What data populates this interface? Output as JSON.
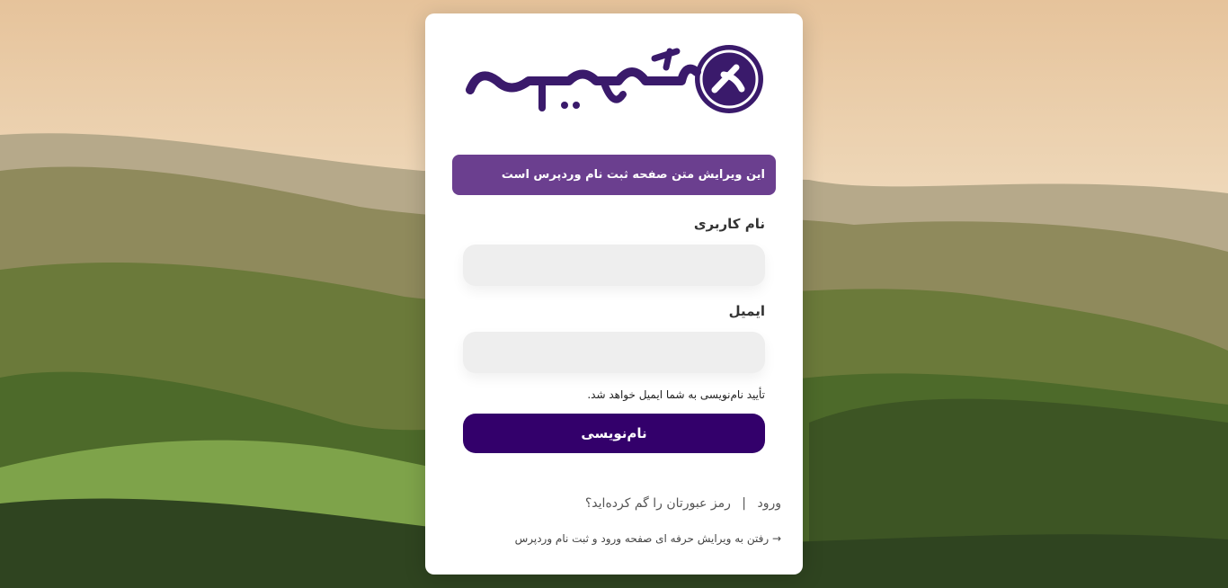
{
  "logo": {
    "text": "گراف وردپرس",
    "mark": "گ",
    "brand_color": "#3a1a6b"
  },
  "notice": {
    "text": "این ویرایش متن صفحه ثبت نام وردپرس است",
    "color": "#6b3f8f"
  },
  "form": {
    "username_label": "نام کاربری",
    "username_value": "",
    "email_label": "ایمیل",
    "email_value": "",
    "hint": "تأیید نام‌نویسی به شما ایمیل خواهد شد.",
    "submit_label": "نام‌نویسی",
    "submit_color": "#33006b"
  },
  "nav": {
    "login": "ورود",
    "separator": "|",
    "lost_password": "رمز عبورتان را گم کرده‌اید؟"
  },
  "backlink": {
    "text": "→ رفتن به ویرایش حرفه ای صفحه ورود و ثبت نام وردپرس"
  }
}
